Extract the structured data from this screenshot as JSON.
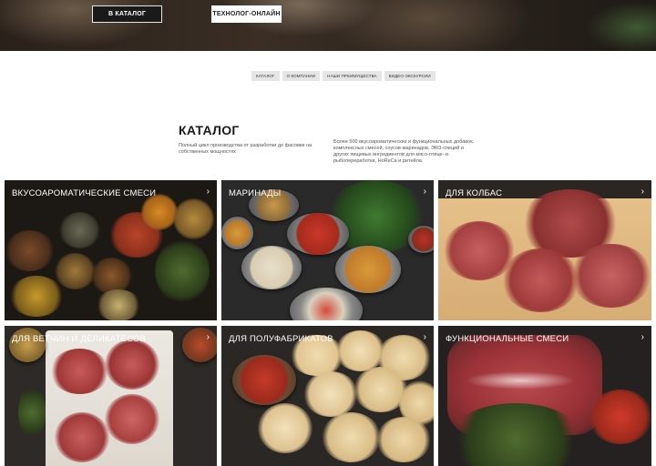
{
  "hero": {
    "catalog_button": "В КАТАЛОГ",
    "technologist_button": "ТЕХНОЛОГ-ОНЛАЙН"
  },
  "tabs": [
    {
      "label": "КАТАЛОГ"
    },
    {
      "label": "О КОМПАНИИ"
    },
    {
      "label": "НАШИ ПРЕИМУЩЕСТВА"
    },
    {
      "label": "ВИДЕО-ЭКСКУРСИИ"
    }
  ],
  "catalog": {
    "title": "КАТАЛОГ",
    "lead": "Полный цикл производства от разработки до фасовки на собственных мощностях",
    "description": "Более 500 вкусоароматических и функциональных добавок, комплексных смесей, соусов-маринадов, ЭКО-специй и других пищевых ингредиентов для мясо-птице- и рыбопереработки, HoReCa и ритейла."
  },
  "cards": [
    {
      "label": "ВКУСОАРОМАТИЧЕСКИЕ СМЕСИ",
      "arrow": "›"
    },
    {
      "label": "МАРИНАДЫ",
      "arrow": "›"
    },
    {
      "label": "ДЛЯ КОЛБАС",
      "arrow": "›"
    },
    {
      "label": "ДЛЯ ВЕТЧИН И ДЕЛИКАТЕСОВ",
      "arrow": "›"
    },
    {
      "label": "ДЛЯ ПОЛУФАБРИКАТОВ",
      "arrow": "›"
    },
    {
      "label": "ФУНКЦИОНАЛЬНЫЕ СМЕСИ",
      "arrow": "›"
    }
  ]
}
